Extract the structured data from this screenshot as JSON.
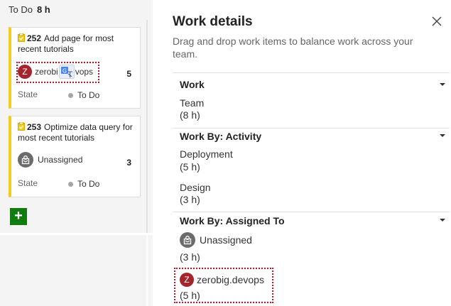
{
  "board": {
    "column_title": "To Do",
    "column_hours": "8 h",
    "cards": [
      {
        "id": "252",
        "title": "Add page for most recent tutorials",
        "assignee": "zerobig.devops",
        "assignee_visible_start": "zerobi",
        "assignee_visible_end": "vops",
        "avatar_letter": "Z",
        "estimate": "5",
        "state_label": "State",
        "state_value": "To Do"
      },
      {
        "id": "253",
        "title": "Optimize data query for most recent tutorials",
        "assignee": "Unassigned",
        "estimate": "3",
        "state_label": "State",
        "state_value": "To Do"
      }
    ],
    "add_button_label": "+"
  },
  "panel": {
    "title": "Work details",
    "description": "Drag and drop work items to balance work across your team.",
    "sections": {
      "work": {
        "header": "Work",
        "items": [
          {
            "name": "Team",
            "hours": "(8 h)"
          }
        ]
      },
      "activity": {
        "header": "Work By: Activity",
        "items": [
          {
            "name": "Deployment",
            "hours": "(5 h)"
          },
          {
            "name": "Design",
            "hours": "(3 h)"
          }
        ]
      },
      "assigned": {
        "header": "Work By: Assigned To",
        "items": [
          {
            "name": "Unassigned",
            "hours": "(3 h)"
          },
          {
            "name": "zerobig.devops",
            "hours": "(5 h)",
            "avatar_letter": "Z"
          }
        ]
      }
    }
  },
  "colors": {
    "card_accent": "#f2cb1d",
    "avatar_red": "#a4262c",
    "drag_outline": "#c50f1f",
    "add_button": "#107c10"
  },
  "icons": [
    "clipboard-icon",
    "translate-icon",
    "close-icon",
    "chevron-down-icon",
    "unassigned-avatar-icon",
    "plus-icon"
  ]
}
